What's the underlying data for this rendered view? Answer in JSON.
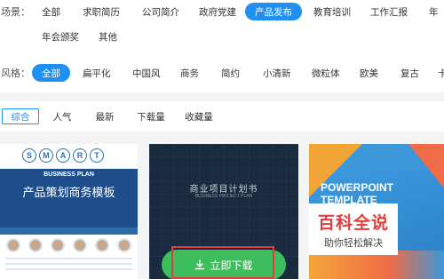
{
  "filters": {
    "scene_label": "场景：",
    "scene_tags": [
      "全部",
      "求职简历",
      "公司简介",
      "政府党建",
      "产品发布",
      "教育培训",
      "工作汇报",
      "年"
    ],
    "scene_tags_row2": [
      "年会颁奖",
      "其他"
    ],
    "scene_active_index": 4,
    "style_label": "风格：",
    "style_tags": [
      "全部",
      "扁平化",
      "中国风",
      "商务",
      "简约",
      "小清新",
      "微粒体",
      "欧美",
      "复古",
      "卡"
    ],
    "style_active_index": 0
  },
  "sort": {
    "tabs": [
      "综合",
      "人气",
      "最新",
      "下载量",
      "收藏量"
    ],
    "active_index": 0
  },
  "cards": {
    "card1": {
      "smart_letters": [
        "S",
        "M",
        "A",
        "R",
        "T"
      ],
      "subtitle": "BUSINESS PLAN",
      "title": "产品策划商务模板"
    },
    "card2": {
      "title": "商业项目计划书",
      "subtitle": "BUSINESS PROJECT PLAN",
      "download_label": "立即下载"
    },
    "card3": {
      "title_line1": "POWERPOINT",
      "title_line2": "TEMPLATE"
    }
  },
  "watermark": {
    "title": "百科全说",
    "subtitle": "助你轻松解决"
  },
  "colors": {
    "accent": "#1f8ff2",
    "download": "#3dbd5c",
    "highlight": "#e23d3d"
  },
  "icons": {
    "download": "download-arrow-icon"
  }
}
